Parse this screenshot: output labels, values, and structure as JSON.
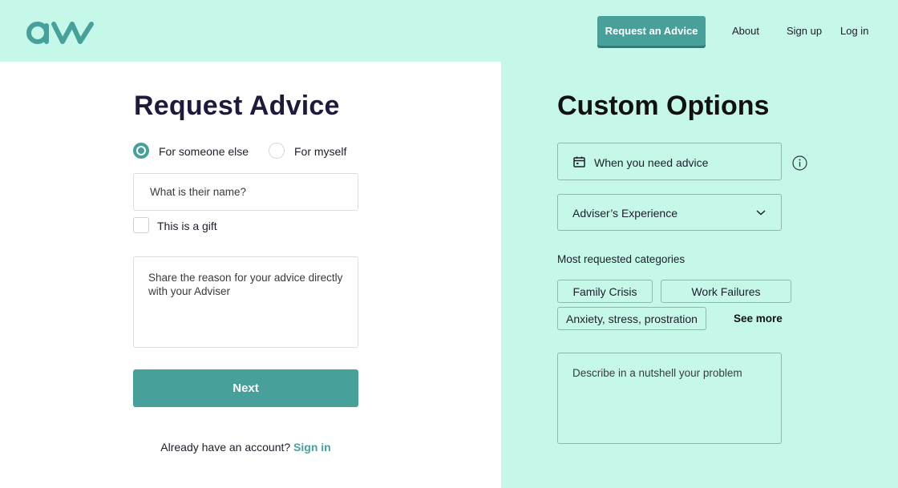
{
  "brand": {
    "logo_text": "avv",
    "accent_color": "#48a09b",
    "panel_color": "#c5f8e9"
  },
  "nav": {
    "cta_label": "Request an Advice",
    "links": [
      "About",
      "Sign up",
      "Log in"
    ]
  },
  "request": {
    "title": "Request Advice",
    "radio_options": [
      {
        "label": "For someone else",
        "selected": true
      },
      {
        "label": "For myself",
        "selected": false
      }
    ],
    "name_placeholder": "What is their name?",
    "gift_label": "This is a gift",
    "gift_checked": false,
    "reason_placeholder": "Share the reason for your advice directly with your Adviser",
    "next_label": "Next",
    "account_prompt": "Already have an account?",
    "signin_label": "Sign in"
  },
  "custom": {
    "title": "Custom Options",
    "when_label": "When you need advice",
    "when_icon": "calendar-icon",
    "info_icon": "info-icon",
    "experience_label": "Adviser’s Experience",
    "experience_icon": "chevron-down-icon",
    "categories_label": "Most requested categories",
    "categories": [
      "Family Crisis",
      "Work Failures",
      "Anxiety, stress, prostration"
    ],
    "see_more_label": "See  more",
    "problem_placeholder": "Describe in a nutshell your problem"
  }
}
